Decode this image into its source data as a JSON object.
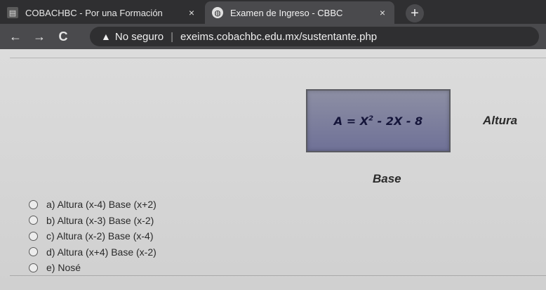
{
  "browser": {
    "tabs": [
      {
        "favicon": "document-icon",
        "title": "COBACHBC - Por una Formación",
        "close": "×"
      },
      {
        "favicon": "globe-icon",
        "title": "Examen de Ingreso - CBBC",
        "close": "×"
      }
    ],
    "new_tab": "+",
    "nav": {
      "back": "←",
      "forward": "→",
      "reload": "C"
    },
    "address": {
      "security_icon": "warning-icon",
      "security_glyph": "▲",
      "security_text": "No seguro",
      "separator": "|",
      "url": "exeims.cobachbc.edu.mx/sustentante.php"
    }
  },
  "question": {
    "formula_prefix": "A = X",
    "formula_exponent": "2",
    "formula_suffix": " - 2X - 8",
    "side_label": "Altura",
    "bottom_label": "Base"
  },
  "options": [
    {
      "label": "a) Altura (x-4) Base (x+2)"
    },
    {
      "label": "b) Altura (x-3) Base (x-2)"
    },
    {
      "label": "c) Altura (x-2) Base (x-4)"
    },
    {
      "label": "d) Altura (x+4) Base (x-2)"
    },
    {
      "label": "e) Nosé"
    }
  ]
}
